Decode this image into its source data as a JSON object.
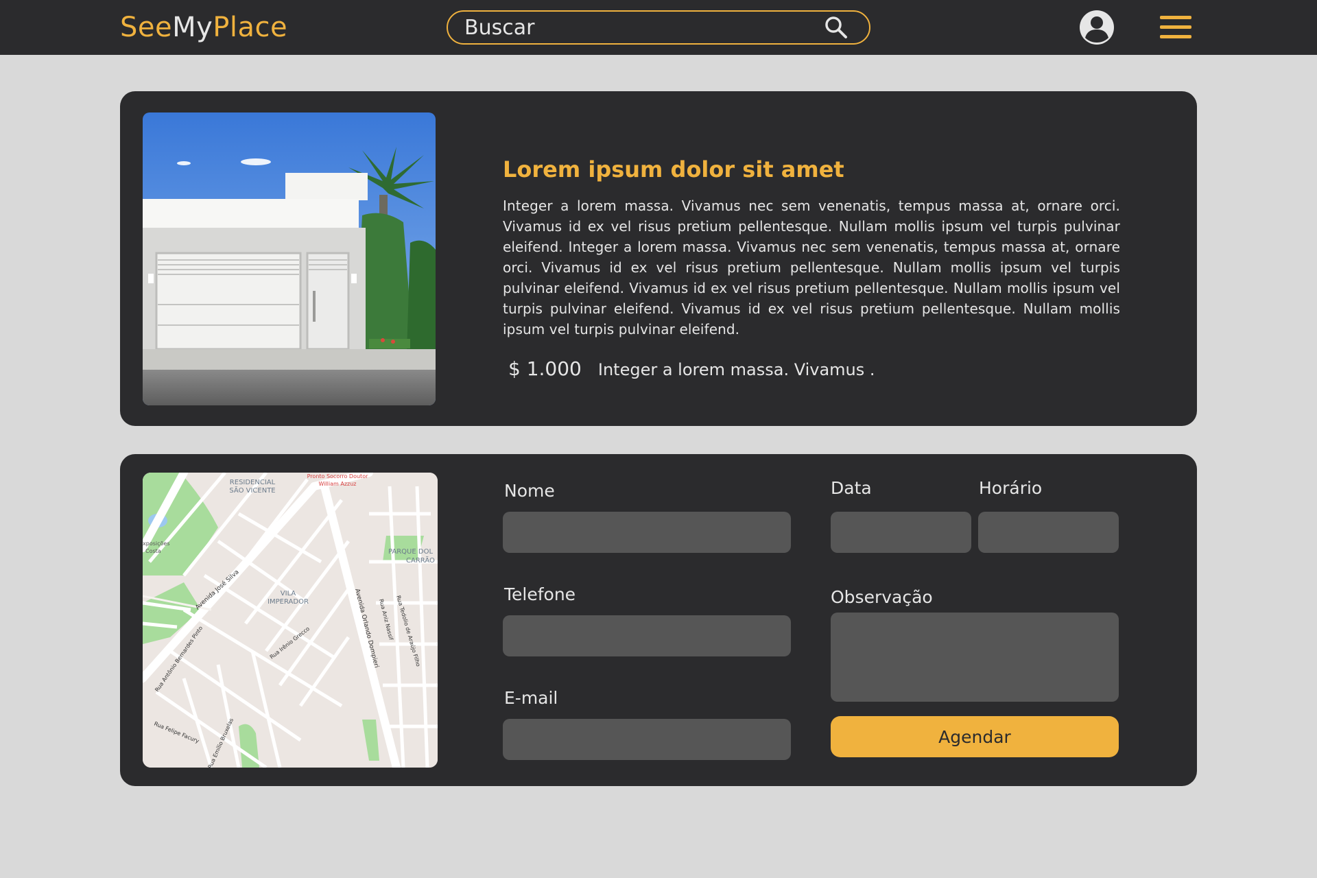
{
  "header": {
    "logo_see": "See",
    "logo_my": "My",
    "logo_place": "Place",
    "search_placeholder": "Buscar"
  },
  "listing": {
    "title": "Lorem ipsum dolor sit amet",
    "description": "Integer a lorem massa. Vivamus nec sem venenatis, tempus massa at, ornare orci. Vivamus id ex vel risus pretium pellentesque. Nullam mollis ipsum vel turpis pulvinar eleifend.  Integer a lorem massa. Vivamus nec sem venenatis, tempus massa at, ornare orci. Vivamus id ex vel risus pretium pellentesque. Nullam mollis ipsum vel turpis pulvinar eleifend. Vivamus id ex vel risus pretium pellentesque. Nullam mollis ipsum vel turpis pulvinar eleifend. Vivamus id ex vel risus pretium pellentesque. Nullam mollis ipsum vel turpis pulvinar eleifend.",
    "price": "$ 1.000",
    "price_note": "Integer a lorem massa. Vivamus ."
  },
  "map": {
    "labels": {
      "residencial": "RESIDENCIAL",
      "sao_vicente": "SÃO VICENTE",
      "pronto_1": "Pronto Socorro Doutor",
      "pronto_2": "William Azzuz",
      "exposicoes_1": "xposições",
      "exposicoes_2": "Costa",
      "parque_1": "PARQUE DOL",
      "parque_2": "CARRÃO",
      "vila_1": "VILA",
      "vila_2": "IMPERADOR",
      "av_jose": "Avenida José Silva",
      "av_orlando": "Avenida Orlando Dompieri",
      "r_aniz": "Rua Aniz Nassif",
      "r_tedolio": "Rua Tedolio de Araújo Filho",
      "r_irenio": "Rua Irênio Grecco",
      "r_bernardes": "Rua Antônio Bernardes Pinto",
      "r_facury": "Rua Felipe Facury",
      "r_bruxelas": "Rua Emílio Bruxelas"
    }
  },
  "form": {
    "nome_label": "Nome",
    "telefone_label": "Telefone",
    "email_label": "E-mail",
    "data_label": "Data",
    "horario_label": "Horário",
    "observacao_label": "Observação",
    "submit_label": "Agendar",
    "values": {
      "nome": "",
      "telefone": "",
      "email": "",
      "data": "",
      "horario": "",
      "observacao": ""
    }
  },
  "colors": {
    "accent": "#f0b23e",
    "surface": "#2b2b2d",
    "page_bg": "#d9d9d9",
    "input_bg": "#565656"
  },
  "icons": {
    "search": "search-icon",
    "user": "user-avatar-icon",
    "menu": "hamburger-menu-icon"
  }
}
